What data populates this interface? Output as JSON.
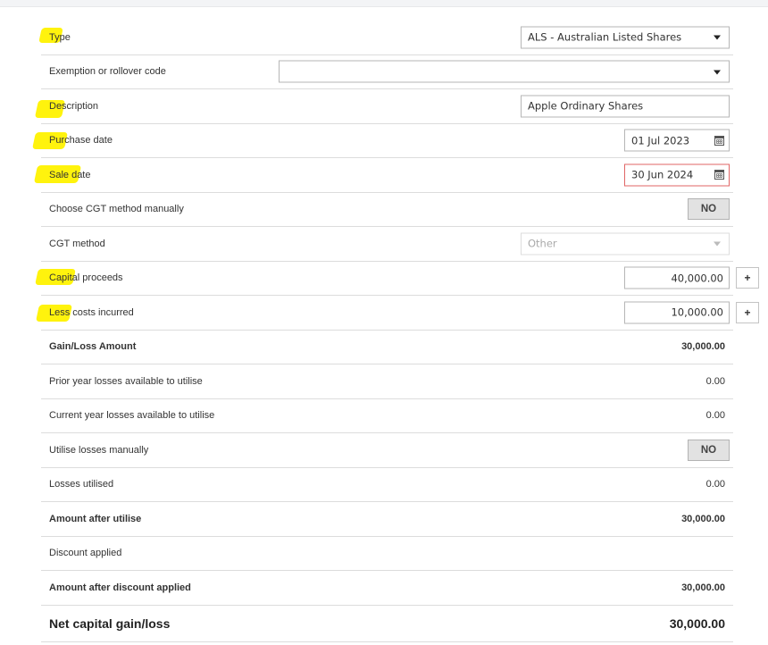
{
  "rows": {
    "type": {
      "label": "Type",
      "value": "ALS - Australian Listed Shares"
    },
    "exemption": {
      "label": "Exemption or rollover code",
      "value": ""
    },
    "description": {
      "label": "Description",
      "value": "Apple Ordinary Shares"
    },
    "purchase_date": {
      "label": "Purchase date",
      "value": "01 Jul 2023"
    },
    "sale_date": {
      "label": "Sale date",
      "value": "30 Jun 2024"
    },
    "choose_cgt": {
      "label": "Choose CGT method manually",
      "toggle": "NO"
    },
    "cgt_method": {
      "label": "CGT method",
      "value": "Other"
    },
    "capital_proceeds": {
      "label": "Capital proceeds",
      "value": "40,000.00",
      "add": "+"
    },
    "less_costs": {
      "label": "Less costs incurred",
      "value": "10,000.00",
      "add": "+"
    },
    "gain_loss": {
      "label": "Gain/Loss Amount",
      "value": "30,000.00"
    },
    "prior_losses": {
      "label": "Prior year losses available to utilise",
      "value": "0.00"
    },
    "current_losses": {
      "label": "Current year losses available to utilise",
      "value": "0.00"
    },
    "utilise_manually": {
      "label": "Utilise losses manually",
      "toggle": "NO"
    },
    "losses_utilised": {
      "label": "Losses utilised",
      "value": "0.00"
    },
    "after_utilise": {
      "label": "Amount after utilise",
      "value": "30,000.00"
    },
    "discount": {
      "label": "Discount applied",
      "value": ""
    },
    "after_discount": {
      "label": "Amount after discount applied",
      "value": "30,000.00"
    },
    "net_gain": {
      "label": "Net capital gain/loss",
      "value": "30,000.00"
    }
  },
  "colors": {
    "highlight": "#fff200",
    "error_border": "#e06666",
    "toggle_bg": "#e2e2e2"
  }
}
